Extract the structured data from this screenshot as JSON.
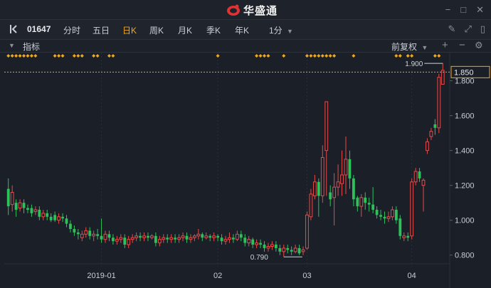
{
  "app": {
    "name": "华盛通",
    "win_icons": [
      "minimize-icon",
      "maximize-icon",
      "close-icon"
    ]
  },
  "toolbar": {
    "code": "01647",
    "tabs": [
      {
        "label": "分时",
        "active": false
      },
      {
        "label": "五日",
        "active": false
      },
      {
        "label": "日K",
        "active": true
      },
      {
        "label": "周K",
        "active": false
      },
      {
        "label": "月K",
        "active": false
      },
      {
        "label": "季K",
        "active": false
      },
      {
        "label": "年K",
        "active": false
      }
    ],
    "minute_select": "1分",
    "icons": [
      "pencil-icon",
      "fullscreen-icon",
      "panel-icon"
    ]
  },
  "indicator_bar": {
    "label": "指标",
    "adjust": "前复权",
    "plus": "+",
    "minus": "−"
  },
  "colors": {
    "up": "#e84a4a",
    "down": "#2ec15a",
    "accent": "#f0a81c",
    "bg": "#1b1f27",
    "text": "#c9ced6",
    "grid": "#2a2f38"
  },
  "chart_data": {
    "type": "candlestick",
    "ylim": [
      0.75,
      1.88
    ],
    "y_ticks": [
      "0.800",
      "1.000",
      "1.200",
      "1.400",
      "1.600",
      "1.800"
    ],
    "x_labels": [
      {
        "label": "2019-01",
        "index": 24
      },
      {
        "label": "02",
        "index": 54
      },
      {
        "label": "03",
        "index": 77
      },
      {
        "label": "04",
        "index": 104
      }
    ],
    "current_price": "1.850",
    "max_label": "1.900",
    "min_label": "0.790",
    "event_markers": [
      0,
      1,
      2,
      3,
      4,
      5,
      6,
      7,
      12,
      13,
      14,
      17,
      18,
      19,
      22,
      23,
      26,
      27,
      54,
      64,
      65,
      66,
      67,
      71,
      77,
      78,
      79,
      80,
      81,
      82,
      83,
      84,
      89,
      100,
      101,
      103,
      104,
      110,
      111
    ],
    "candles": [
      [
        1.18,
        1.08,
        1.24,
        1.03
      ],
      [
        1.09,
        1.16,
        1.2,
        1.05
      ],
      [
        1.1,
        1.06,
        1.12,
        1.02
      ],
      [
        1.07,
        1.1,
        1.12,
        1.05
      ],
      [
        1.1,
        1.07,
        1.12,
        1.04
      ],
      [
        1.07,
        1.06,
        1.09,
        1.04
      ],
      [
        1.07,
        1.04,
        1.09,
        1.02
      ],
      [
        1.05,
        1.06,
        1.08,
        1.03
      ],
      [
        1.06,
        1.02,
        1.08,
        1.0
      ],
      [
        1.02,
        1.04,
        1.06,
        1.0
      ],
      [
        1.04,
        1.02,
        1.06,
        1.0
      ],
      [
        1.02,
        1.0,
        1.04,
        0.99
      ],
      [
        1.03,
        1.0,
        1.05,
        0.99
      ],
      [
        1.0,
        1.02,
        1.04,
        0.98
      ],
      [
        1.02,
        1.01,
        1.04,
        0.99
      ],
      [
        1.01,
        0.98,
        1.03,
        0.96
      ],
      [
        0.98,
        0.95,
        1.0,
        0.93
      ],
      [
        0.95,
        0.93,
        0.97,
        0.91
      ],
      [
        0.93,
        0.92,
        0.95,
        0.89
      ],
      [
        0.9,
        0.92,
        0.94,
        0.88
      ],
      [
        0.92,
        0.94,
        0.96,
        0.9
      ],
      [
        0.94,
        0.91,
        0.96,
        0.89
      ],
      [
        0.91,
        0.92,
        0.94,
        0.88
      ],
      [
        0.92,
        0.91,
        0.95,
        0.89
      ],
      [
        0.91,
        0.89,
        1.01,
        0.87
      ],
      [
        0.89,
        0.92,
        0.94,
        0.87
      ],
      [
        0.92,
        0.9,
        0.94,
        0.88
      ],
      [
        0.9,
        0.88,
        0.92,
        0.86
      ],
      [
        0.88,
        0.89,
        0.91,
        0.86
      ],
      [
        0.89,
        0.9,
        0.92,
        0.87
      ],
      [
        0.9,
        0.86,
        0.92,
        0.84
      ],
      [
        0.86,
        0.89,
        0.91,
        0.84
      ],
      [
        0.89,
        0.9,
        0.92,
        0.87
      ],
      [
        0.9,
        0.91,
        0.93,
        0.88
      ],
      [
        0.91,
        0.9,
        0.93,
        0.88
      ],
      [
        0.9,
        0.91,
        0.93,
        0.88
      ],
      [
        0.91,
        0.9,
        0.93,
        0.88
      ],
      [
        0.9,
        0.91,
        0.92,
        0.89
      ],
      [
        0.91,
        0.87,
        0.93,
        0.85
      ],
      [
        0.87,
        0.89,
        0.91,
        0.85
      ],
      [
        0.89,
        0.9,
        0.92,
        0.87
      ],
      [
        0.9,
        0.89,
        0.92,
        0.87
      ],
      [
        0.89,
        0.9,
        0.92,
        0.87
      ],
      [
        0.9,
        0.89,
        0.92,
        0.87
      ],
      [
        0.89,
        0.9,
        0.92,
        0.87
      ],
      [
        0.9,
        0.91,
        0.93,
        0.88
      ],
      [
        0.91,
        0.89,
        0.93,
        0.87
      ],
      [
        0.89,
        0.9,
        0.92,
        0.87
      ],
      [
        0.9,
        0.91,
        0.92,
        0.88
      ],
      [
        0.91,
        0.92,
        0.95,
        0.89
      ],
      [
        0.92,
        0.9,
        0.93,
        0.88
      ],
      [
        0.9,
        0.91,
        0.93,
        0.89
      ],
      [
        0.91,
        0.9,
        0.92,
        0.88
      ],
      [
        0.9,
        0.91,
        0.93,
        0.88
      ],
      [
        0.91,
        0.9,
        0.92,
        0.88
      ],
      [
        0.9,
        0.88,
        0.92,
        0.86
      ],
      [
        0.88,
        0.89,
        0.91,
        0.86
      ],
      [
        0.89,
        0.9,
        0.93,
        0.87
      ],
      [
        0.9,
        0.89,
        0.92,
        0.87
      ],
      [
        0.89,
        0.92,
        0.94,
        0.88
      ],
      [
        0.92,
        0.9,
        0.94,
        0.88
      ],
      [
        0.9,
        0.87,
        0.92,
        0.85
      ],
      [
        0.87,
        0.89,
        0.91,
        0.85
      ],
      [
        0.89,
        0.86,
        0.9,
        0.84
      ],
      [
        0.86,
        0.87,
        0.89,
        0.84
      ],
      [
        0.87,
        0.86,
        0.89,
        0.84
      ],
      [
        0.86,
        0.84,
        0.88,
        0.82
      ],
      [
        0.84,
        0.85,
        0.87,
        0.82
      ],
      [
        0.85,
        0.86,
        0.88,
        0.83
      ],
      [
        0.86,
        0.84,
        0.88,
        0.82
      ],
      [
        0.84,
        0.82,
        0.86,
        0.8
      ],
      [
        0.82,
        0.84,
        0.86,
        0.79
      ],
      [
        0.84,
        0.83,
        0.86,
        0.81
      ],
      [
        0.83,
        0.82,
        0.85,
        0.8
      ],
      [
        0.82,
        0.84,
        0.86,
        0.81
      ],
      [
        0.84,
        0.81,
        0.86,
        0.8
      ],
      [
        0.82,
        0.83,
        0.85,
        0.8
      ],
      [
        0.84,
        1.03,
        1.05,
        0.83
      ],
      [
        1.02,
        1.15,
        1.18,
        1.0
      ],
      [
        1.14,
        1.22,
        1.26,
        1.12
      ],
      [
        1.22,
        1.14,
        1.24,
        1.02
      ],
      [
        1.14,
        1.36,
        1.43,
        1.1
      ],
      [
        1.4,
        1.68,
        1.68,
        1.14
      ],
      [
        1.16,
        1.12,
        1.2,
        1.08
      ],
      [
        1.13,
        1.19,
        1.27,
        0.97
      ],
      [
        1.19,
        1.22,
        1.32,
        1.14
      ],
      [
        1.21,
        1.26,
        1.4,
        1.14
      ],
      [
        1.26,
        1.35,
        1.48,
        1.15
      ],
      [
        1.35,
        1.24,
        1.4,
        1.18
      ],
      [
        1.24,
        1.12,
        1.26,
        1.08
      ],
      [
        1.13,
        1.08,
        1.14,
        1.05
      ],
      [
        1.08,
        1.13,
        1.15,
        1.02
      ],
      [
        1.13,
        1.1,
        1.16,
        1.06
      ],
      [
        1.1,
        1.09,
        1.13,
        1.05
      ],
      [
        1.09,
        1.06,
        1.19,
        1.04
      ],
      [
        1.06,
        1.03,
        1.08,
        1.01
      ],
      [
        1.03,
        1.02,
        1.06,
        1.0
      ],
      [
        1.02,
        1.01,
        1.05,
        0.98
      ],
      [
        1.01,
        1.02,
        1.05,
        0.99
      ],
      [
        1.02,
        1.06,
        1.08,
        1.0
      ],
      [
        1.06,
        1.0,
        1.08,
        0.98
      ],
      [
        1.01,
        0.91,
        1.03,
        0.89
      ],
      [
        0.9,
        0.91,
        0.93,
        0.88
      ],
      [
        0.91,
        0.9,
        0.93,
        0.88
      ],
      [
        0.91,
        1.22,
        1.24,
        0.89
      ],
      [
        1.22,
        1.28,
        1.3,
        1.2
      ],
      [
        1.28,
        1.24,
        1.3,
        1.22
      ],
      [
        1.2,
        1.23,
        1.24,
        1.05
      ],
      [
        1.4,
        1.45,
        1.47,
        1.38
      ],
      [
        1.48,
        1.51,
        1.53,
        1.46
      ],
      [
        1.55,
        1.53,
        1.58,
        1.49
      ],
      [
        1.53,
        1.82,
        1.84,
        1.5
      ],
      [
        1.78,
        1.86,
        1.9,
        1.78
      ]
    ]
  }
}
